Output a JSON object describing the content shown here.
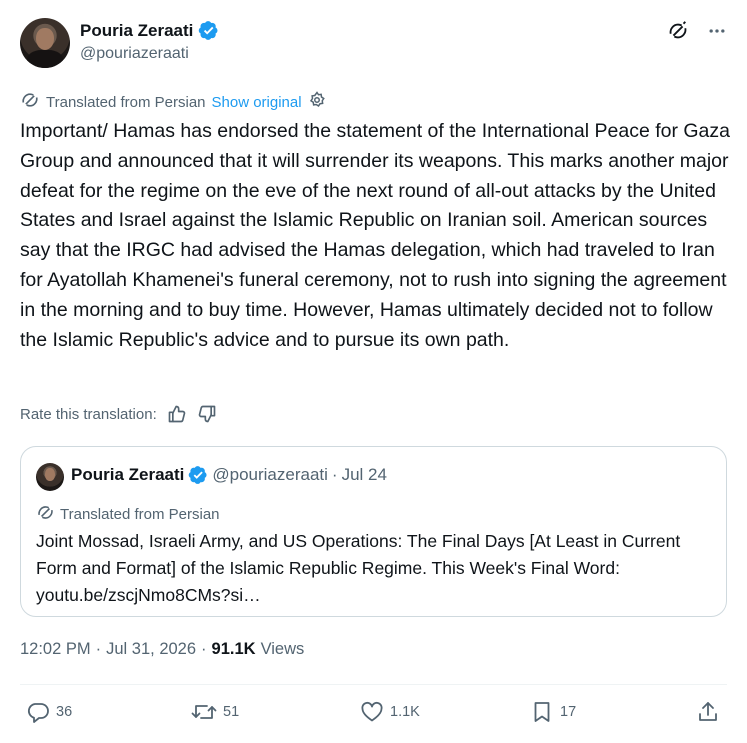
{
  "author": {
    "name": "Pouria Zeraati",
    "handle": "@pouriazeraati"
  },
  "translation": {
    "label": "Translated from Persian",
    "show_original": "Show original"
  },
  "tweet": {
    "text": "Important/ Hamas has endorsed the statement of the International Peace for Gaza Group and announced that it will surrender its weapons. This marks another major defeat for the regime on the eve of the next round of all-out attacks by the United States and Israel against the Islamic Republic on Iranian soil. American sources say that the IRGC had advised the Hamas delegation, which had traveled to Iran for Ayatollah Khamenei's funeral ceremony, not to rush into signing the agreement in the morning and to buy time. However, Hamas ultimately decided not to follow the Islamic Republic's advice and to pursue its own path."
  },
  "rate": {
    "label": "Rate this translation:"
  },
  "quote": {
    "name": "Pouria Zeraati",
    "handle": "@pouriazeraati",
    "separator": "·",
    "date": "Jul 24",
    "translated_label": "Translated from Persian",
    "text": "Joint Mossad, Israeli Army, and US Operations: The Final Days [At Least in Current Form and Format] of the Islamic Republic Regime. This Week's Final Word: youtu.be/zscjNmo8CMs?si…"
  },
  "meta": {
    "time": "12:02 PM",
    "separator": "·",
    "date": "Jul 31, 2026",
    "separator2": "·",
    "views_count": "91.1K",
    "views_label": "Views"
  },
  "actions": {
    "replies": "36",
    "reposts": "51",
    "likes": "1.1K",
    "bookmarks": "17"
  },
  "colors": {
    "accent": "#1d9bf0",
    "text_primary": "#0f1419",
    "text_secondary": "#536471",
    "border": "#cfd9de"
  },
  "icons": [
    "verified-badge-icon",
    "grok-icon",
    "more-icon",
    "translate-icon",
    "settings-icon",
    "thumbs-up-icon",
    "thumbs-down-icon",
    "reply-icon",
    "repost-icon",
    "like-icon",
    "bookmark-icon",
    "share-icon"
  ]
}
